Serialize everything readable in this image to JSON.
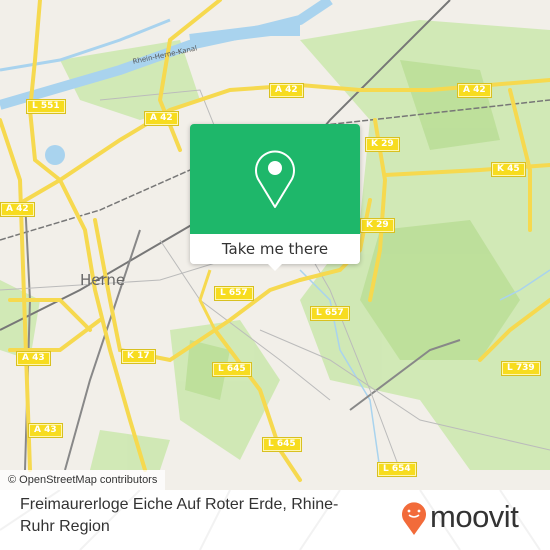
{
  "map": {
    "city_label": "Herne",
    "canal_label": "Rhein-Herne-Kanal",
    "road_labels": [
      {
        "id": "l551",
        "text": "L 551"
      },
      {
        "id": "a42-a",
        "text": "A 42"
      },
      {
        "id": "a42-b",
        "text": "A 42"
      },
      {
        "id": "a42-c",
        "text": "A 42"
      },
      {
        "id": "a42-d",
        "text": "A 42"
      },
      {
        "id": "k29-a",
        "text": "K 29"
      },
      {
        "id": "k29-b",
        "text": "K 29"
      },
      {
        "id": "k45",
        "text": "K 45"
      },
      {
        "id": "l657-a",
        "text": "L 657"
      },
      {
        "id": "l657-b",
        "text": "L 657"
      },
      {
        "id": "k17",
        "text": "K 17"
      },
      {
        "id": "a43-a",
        "text": "A 43"
      },
      {
        "id": "a43-b",
        "text": "A 43"
      },
      {
        "id": "l645-a",
        "text": "L 645"
      },
      {
        "id": "l645-b",
        "text": "L 645"
      },
      {
        "id": "l739",
        "text": "L 739"
      },
      {
        "id": "l654",
        "text": "L 654"
      }
    ],
    "attribution": "© OpenStreetMap contributors"
  },
  "popup": {
    "icon": "map-pin-icon",
    "button_label": "Take me there",
    "color": "#1eb76a"
  },
  "footer": {
    "place_name": "Freimaurerloge Eiche Auf Roter Erde, Rhine-Ruhr Region",
    "brand": "moovit",
    "brand_color": "#f26b3a"
  }
}
